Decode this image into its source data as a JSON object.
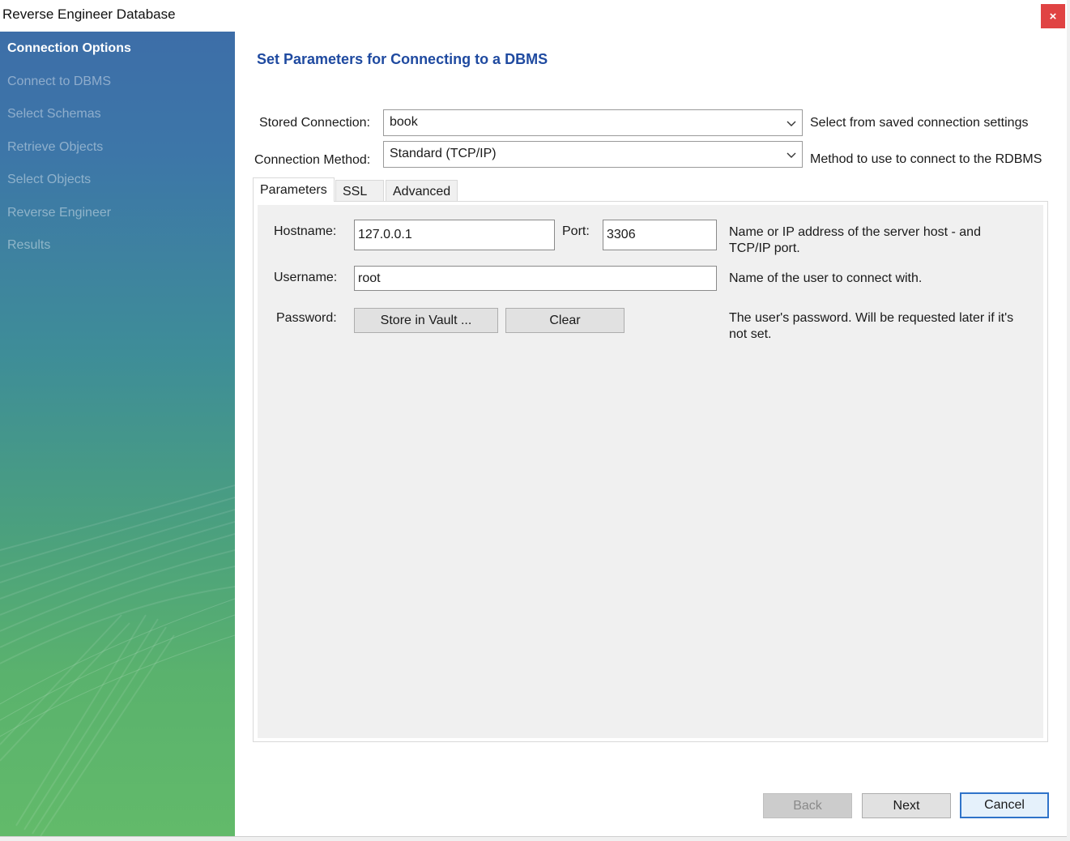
{
  "window": {
    "title": "Reverse Engineer Database",
    "close_glyph": "×"
  },
  "sidebar": {
    "items": [
      {
        "label": "Connection Options",
        "active": true
      },
      {
        "label": "Connect to DBMS",
        "active": false
      },
      {
        "label": "Select Schemas",
        "active": false
      },
      {
        "label": "Retrieve Objects",
        "active": false
      },
      {
        "label": "Select Objects",
        "active": false
      },
      {
        "label": "Reverse Engineer",
        "active": false
      },
      {
        "label": "Results",
        "active": false
      }
    ]
  },
  "page": {
    "title": "Set Parameters for Connecting to a DBMS",
    "stored_connection": {
      "label": "Stored Connection:",
      "value": "book",
      "help": "Select from saved connection settings"
    },
    "connection_method": {
      "label": "Connection Method:",
      "value": "Standard (TCP/IP)",
      "help": "Method to use to connect to the RDBMS"
    },
    "tabs": [
      {
        "label": "Parameters",
        "active": true
      },
      {
        "label": "SSL",
        "active": false
      },
      {
        "label": "Advanced",
        "active": false
      }
    ],
    "parameters": {
      "hostname": {
        "label": "Hostname:",
        "value": "127.0.0.1"
      },
      "port": {
        "label": "Port:",
        "value": "3306"
      },
      "host_help_line1": "Name or IP address of the server host - and",
      "host_help_line2": "TCP/IP port.",
      "username": {
        "label": "Username:",
        "value": "root",
        "help": "Name of the user to connect with."
      },
      "password": {
        "label": "Password:",
        "store_button": "Store in Vault ...",
        "clear_button": "Clear",
        "help_line1": "The user's password. Will be requested later if it's",
        "help_line2": "not set."
      }
    }
  },
  "footer": {
    "back": "Back",
    "next": "Next",
    "cancel": "Cancel"
  },
  "colors": {
    "accent": "#1f4aa0",
    "close": "#e04343",
    "primary_border": "#2f73c9"
  },
  "icons": {
    "combo_arrow": "chevron-down-icon",
    "close": "close-icon"
  }
}
